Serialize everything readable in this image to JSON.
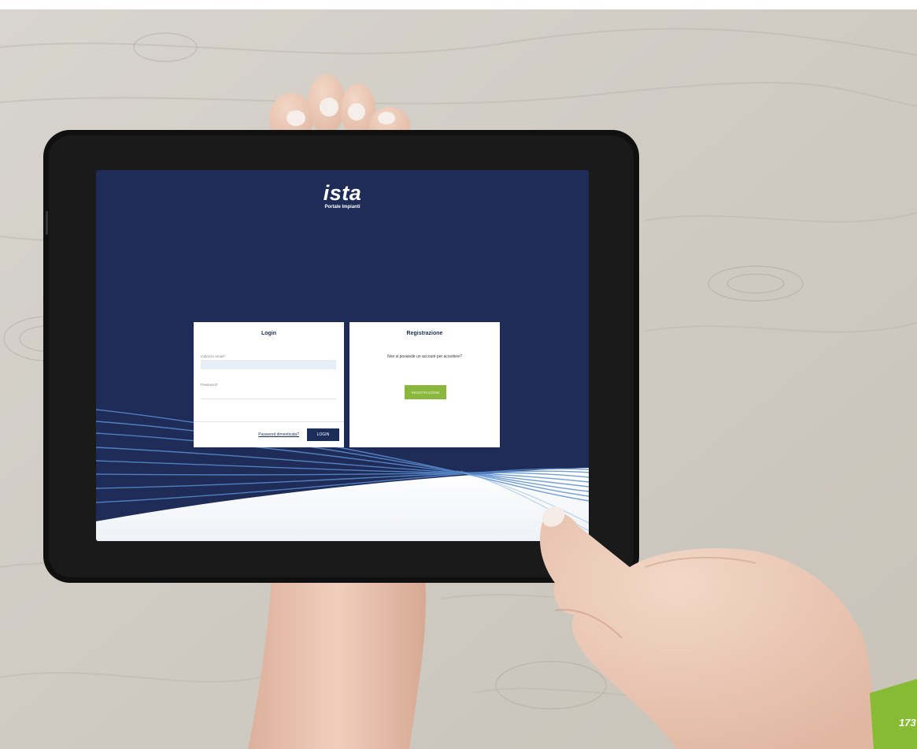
{
  "app": {
    "logo": "ista",
    "subtitle": "Portale Impianti"
  },
  "login": {
    "title": "Login",
    "email_label": "Indirizzo email*",
    "email_value": "",
    "password_label": "Password*",
    "forgot_link": "Password dimenticata?",
    "login_button": "LOGIN"
  },
  "registration": {
    "title": "Registrazione",
    "prompt": "Non si possiede un account per accedere?",
    "register_button": "REGISTRAZIONE"
  },
  "page_number": "173",
  "colors": {
    "screen_background": "#1f2c58",
    "primary": "#1b2d59",
    "accent_green": "#8ab83c",
    "email_field_bg": "#e6eef8",
    "page_tab": "#86bb33"
  },
  "icons": [
    "ista-logo"
  ]
}
